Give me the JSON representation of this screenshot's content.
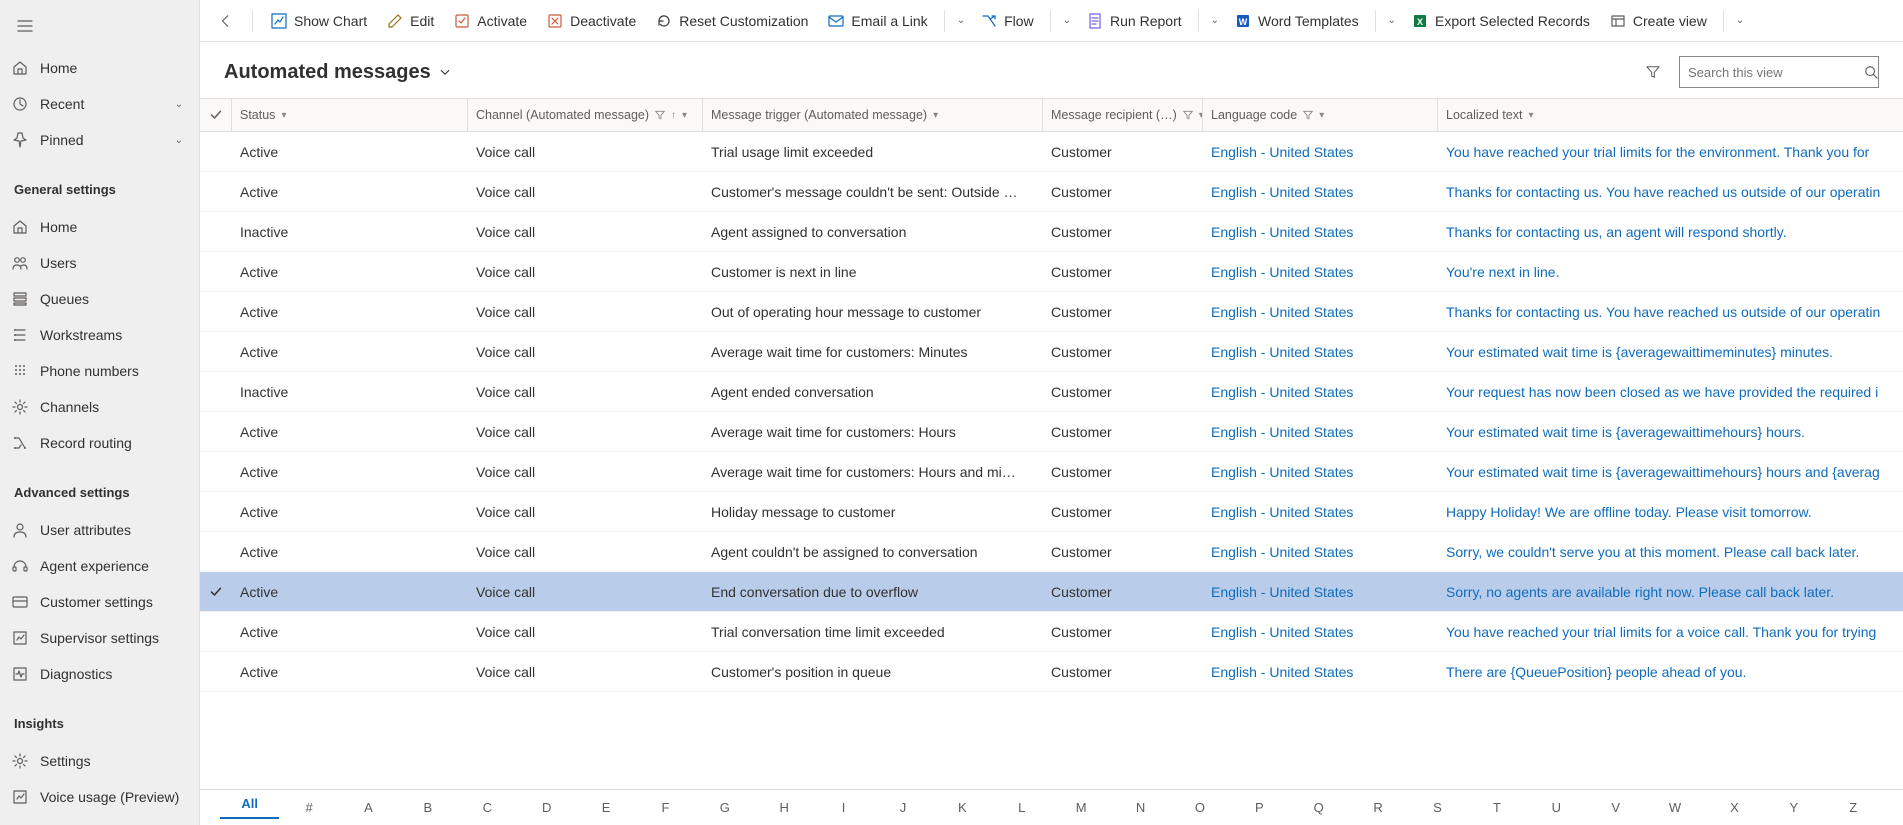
{
  "sidebar": {
    "topItems": [
      {
        "label": "Home",
        "icon": "home",
        "chevron": false
      },
      {
        "label": "Recent",
        "icon": "clock",
        "chevron": true
      },
      {
        "label": "Pinned",
        "icon": "pin",
        "chevron": true
      }
    ],
    "sections": [
      {
        "heading": "General settings",
        "items": [
          {
            "label": "Home",
            "icon": "home"
          },
          {
            "label": "Users",
            "icon": "users"
          },
          {
            "label": "Queues",
            "icon": "queues"
          },
          {
            "label": "Workstreams",
            "icon": "workstreams"
          },
          {
            "label": "Phone numbers",
            "icon": "dialpad"
          },
          {
            "label": "Channels",
            "icon": "gear"
          },
          {
            "label": "Record routing",
            "icon": "routing"
          }
        ]
      },
      {
        "heading": "Advanced settings",
        "items": [
          {
            "label": "User attributes",
            "icon": "person"
          },
          {
            "label": "Agent experience",
            "icon": "headset"
          },
          {
            "label": "Customer settings",
            "icon": "card"
          },
          {
            "label": "Supervisor settings",
            "icon": "chart"
          },
          {
            "label": "Diagnostics",
            "icon": "diag"
          }
        ]
      },
      {
        "heading": "Insights",
        "items": [
          {
            "label": "Settings",
            "icon": "gear"
          },
          {
            "label": "Voice usage (Preview)",
            "icon": "chart"
          }
        ]
      }
    ]
  },
  "commandBar": [
    {
      "id": "show-chart",
      "label": "Show Chart",
      "icon": "chart-btn",
      "split": false,
      "color": "#0f6cbd"
    },
    {
      "id": "edit",
      "label": "Edit",
      "icon": "edit",
      "split": false,
      "color": "#986f0b"
    },
    {
      "id": "activate",
      "label": "Activate",
      "icon": "activate",
      "split": false,
      "color": "#c9593a"
    },
    {
      "id": "deactivate",
      "label": "Deactivate",
      "icon": "deactivate",
      "split": false,
      "color": "#c9593a"
    },
    {
      "id": "reset",
      "label": "Reset Customization",
      "icon": "reset",
      "split": false,
      "color": "#323130"
    },
    {
      "id": "email-link",
      "label": "Email a Link",
      "icon": "mail",
      "split": true,
      "color": "#0f6cbd"
    },
    {
      "id": "flow",
      "label": "Flow",
      "icon": "flow",
      "split": true,
      "color": "#0f6cbd"
    },
    {
      "id": "run-report",
      "label": "Run Report",
      "icon": "report",
      "split": true,
      "color": "#7160e8"
    },
    {
      "id": "word-templ",
      "label": "Word Templates",
      "icon": "word",
      "split": true,
      "color": "#185abd"
    },
    {
      "id": "export",
      "label": "Export Selected Records",
      "icon": "excel",
      "split": false,
      "color": "#107c41"
    },
    {
      "id": "create-view",
      "label": "Create view",
      "icon": "view",
      "split": true,
      "color": "#605e5c"
    }
  ],
  "page": {
    "title": "Automated messages",
    "searchPlaceholder": "Search this view"
  },
  "columns": {
    "status": "Status",
    "channel": "Channel (Automated message)",
    "trigger": "Message trigger (Automated message)",
    "recip": "Message recipient (…)",
    "lang": "Language code",
    "text": "Localized text"
  },
  "rows": [
    {
      "status": "Active",
      "channel": "Voice call",
      "trigger": "Trial usage limit exceeded",
      "recip": "Customer",
      "lang": "English - United States",
      "text": "You have reached your trial limits for the environment. Thank you for",
      "selected": false
    },
    {
      "status": "Active",
      "channel": "Voice call",
      "trigger": "Customer's message couldn't be sent: Outside …",
      "recip": "Customer",
      "lang": "English - United States",
      "text": "Thanks for contacting us. You have reached us outside of our operatin",
      "selected": false
    },
    {
      "status": "Inactive",
      "channel": "Voice call",
      "trigger": "Agent assigned to conversation",
      "recip": "Customer",
      "lang": "English - United States",
      "text": "Thanks for contacting us, an agent will respond shortly.",
      "selected": false
    },
    {
      "status": "Active",
      "channel": "Voice call",
      "trigger": "Customer is next in line",
      "recip": "Customer",
      "lang": "English - United States",
      "text": "You're next in line.",
      "selected": false
    },
    {
      "status": "Active",
      "channel": "Voice call",
      "trigger": "Out of operating hour message to customer",
      "recip": "Customer",
      "lang": "English - United States",
      "text": "Thanks for contacting us. You have reached us outside of our operatin",
      "selected": false
    },
    {
      "status": "Active",
      "channel": "Voice call",
      "trigger": "Average wait time for customers: Minutes",
      "recip": "Customer",
      "lang": "English - United States",
      "text": "Your estimated wait time is {averagewaittimeminutes} minutes.",
      "selected": false
    },
    {
      "status": "Inactive",
      "channel": "Voice call",
      "trigger": "Agent ended conversation",
      "recip": "Customer",
      "lang": "English - United States",
      "text": "Your request has now been closed as we have provided the required i",
      "selected": false
    },
    {
      "status": "Active",
      "channel": "Voice call",
      "trigger": "Average wait time for customers: Hours",
      "recip": "Customer",
      "lang": "English - United States",
      "text": "Your estimated wait time is {averagewaittimehours} hours.",
      "selected": false
    },
    {
      "status": "Active",
      "channel": "Voice call",
      "trigger": "Average wait time for customers: Hours and mi…",
      "recip": "Customer",
      "lang": "English - United States",
      "text": "Your estimated wait time is {averagewaittimehours} hours and {averag",
      "selected": false
    },
    {
      "status": "Active",
      "channel": "Voice call",
      "trigger": "Holiday message to customer",
      "recip": "Customer",
      "lang": "English - United States",
      "text": "Happy Holiday! We are offline today. Please visit tomorrow.",
      "selected": false
    },
    {
      "status": "Active",
      "channel": "Voice call",
      "trigger": "Agent couldn't be assigned to conversation",
      "recip": "Customer",
      "lang": "English - United States",
      "text": "Sorry, we couldn't serve you at this moment. Please call back later.",
      "selected": false
    },
    {
      "status": "Active",
      "channel": "Voice call",
      "trigger": "End conversation due to overflow",
      "recip": "Customer",
      "lang": "English - United States",
      "text": "Sorry, no agents are available right now. Please call back later.",
      "selected": true
    },
    {
      "status": "Active",
      "channel": "Voice call",
      "trigger": "Trial conversation time limit exceeded",
      "recip": "Customer",
      "lang": "English - United States",
      "text": "You have reached your trial limits for a voice call. Thank you for trying",
      "selected": false
    },
    {
      "status": "Active",
      "channel": "Voice call",
      "trigger": "Customer's position in queue",
      "recip": "Customer",
      "lang": "English - United States",
      "text": "There are {QueuePosition} people ahead of you.",
      "selected": false
    }
  ],
  "alphaBar": [
    "All",
    "#",
    "A",
    "B",
    "C",
    "D",
    "E",
    "F",
    "G",
    "H",
    "I",
    "J",
    "K",
    "L",
    "M",
    "N",
    "O",
    "P",
    "Q",
    "R",
    "S",
    "T",
    "U",
    "V",
    "W",
    "X",
    "Y",
    "Z"
  ]
}
